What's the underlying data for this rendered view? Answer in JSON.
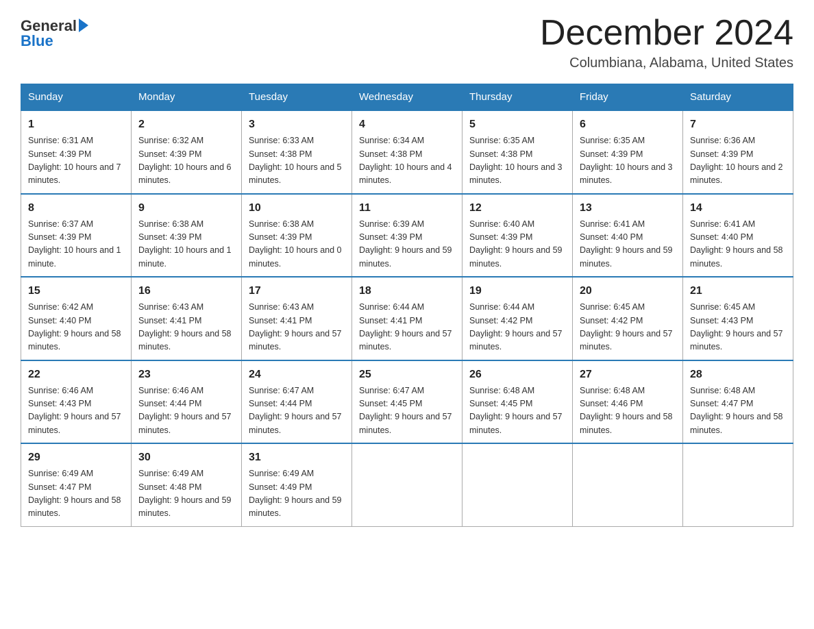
{
  "header": {
    "logo_text_general": "General",
    "logo_text_blue": "Blue",
    "month_title": "December 2024",
    "location": "Columbiana, Alabama, United States"
  },
  "days_of_week": [
    "Sunday",
    "Monday",
    "Tuesday",
    "Wednesday",
    "Thursday",
    "Friday",
    "Saturday"
  ],
  "weeks": [
    [
      {
        "day": "1",
        "sunrise": "Sunrise: 6:31 AM",
        "sunset": "Sunset: 4:39 PM",
        "daylight": "Daylight: 10 hours and 7 minutes."
      },
      {
        "day": "2",
        "sunrise": "Sunrise: 6:32 AM",
        "sunset": "Sunset: 4:39 PM",
        "daylight": "Daylight: 10 hours and 6 minutes."
      },
      {
        "day": "3",
        "sunrise": "Sunrise: 6:33 AM",
        "sunset": "Sunset: 4:38 PM",
        "daylight": "Daylight: 10 hours and 5 minutes."
      },
      {
        "day": "4",
        "sunrise": "Sunrise: 6:34 AM",
        "sunset": "Sunset: 4:38 PM",
        "daylight": "Daylight: 10 hours and 4 minutes."
      },
      {
        "day": "5",
        "sunrise": "Sunrise: 6:35 AM",
        "sunset": "Sunset: 4:38 PM",
        "daylight": "Daylight: 10 hours and 3 minutes."
      },
      {
        "day": "6",
        "sunrise": "Sunrise: 6:35 AM",
        "sunset": "Sunset: 4:39 PM",
        "daylight": "Daylight: 10 hours and 3 minutes."
      },
      {
        "day": "7",
        "sunrise": "Sunrise: 6:36 AM",
        "sunset": "Sunset: 4:39 PM",
        "daylight": "Daylight: 10 hours and 2 minutes."
      }
    ],
    [
      {
        "day": "8",
        "sunrise": "Sunrise: 6:37 AM",
        "sunset": "Sunset: 4:39 PM",
        "daylight": "Daylight: 10 hours and 1 minute."
      },
      {
        "day": "9",
        "sunrise": "Sunrise: 6:38 AM",
        "sunset": "Sunset: 4:39 PM",
        "daylight": "Daylight: 10 hours and 1 minute."
      },
      {
        "day": "10",
        "sunrise": "Sunrise: 6:38 AM",
        "sunset": "Sunset: 4:39 PM",
        "daylight": "Daylight: 10 hours and 0 minutes."
      },
      {
        "day": "11",
        "sunrise": "Sunrise: 6:39 AM",
        "sunset": "Sunset: 4:39 PM",
        "daylight": "Daylight: 9 hours and 59 minutes."
      },
      {
        "day": "12",
        "sunrise": "Sunrise: 6:40 AM",
        "sunset": "Sunset: 4:39 PM",
        "daylight": "Daylight: 9 hours and 59 minutes."
      },
      {
        "day": "13",
        "sunrise": "Sunrise: 6:41 AM",
        "sunset": "Sunset: 4:40 PM",
        "daylight": "Daylight: 9 hours and 59 minutes."
      },
      {
        "day": "14",
        "sunrise": "Sunrise: 6:41 AM",
        "sunset": "Sunset: 4:40 PM",
        "daylight": "Daylight: 9 hours and 58 minutes."
      }
    ],
    [
      {
        "day": "15",
        "sunrise": "Sunrise: 6:42 AM",
        "sunset": "Sunset: 4:40 PM",
        "daylight": "Daylight: 9 hours and 58 minutes."
      },
      {
        "day": "16",
        "sunrise": "Sunrise: 6:43 AM",
        "sunset": "Sunset: 4:41 PM",
        "daylight": "Daylight: 9 hours and 58 minutes."
      },
      {
        "day": "17",
        "sunrise": "Sunrise: 6:43 AM",
        "sunset": "Sunset: 4:41 PM",
        "daylight": "Daylight: 9 hours and 57 minutes."
      },
      {
        "day": "18",
        "sunrise": "Sunrise: 6:44 AM",
        "sunset": "Sunset: 4:41 PM",
        "daylight": "Daylight: 9 hours and 57 minutes."
      },
      {
        "day": "19",
        "sunrise": "Sunrise: 6:44 AM",
        "sunset": "Sunset: 4:42 PM",
        "daylight": "Daylight: 9 hours and 57 minutes."
      },
      {
        "day": "20",
        "sunrise": "Sunrise: 6:45 AM",
        "sunset": "Sunset: 4:42 PM",
        "daylight": "Daylight: 9 hours and 57 minutes."
      },
      {
        "day": "21",
        "sunrise": "Sunrise: 6:45 AM",
        "sunset": "Sunset: 4:43 PM",
        "daylight": "Daylight: 9 hours and 57 minutes."
      }
    ],
    [
      {
        "day": "22",
        "sunrise": "Sunrise: 6:46 AM",
        "sunset": "Sunset: 4:43 PM",
        "daylight": "Daylight: 9 hours and 57 minutes."
      },
      {
        "day": "23",
        "sunrise": "Sunrise: 6:46 AM",
        "sunset": "Sunset: 4:44 PM",
        "daylight": "Daylight: 9 hours and 57 minutes."
      },
      {
        "day": "24",
        "sunrise": "Sunrise: 6:47 AM",
        "sunset": "Sunset: 4:44 PM",
        "daylight": "Daylight: 9 hours and 57 minutes."
      },
      {
        "day": "25",
        "sunrise": "Sunrise: 6:47 AM",
        "sunset": "Sunset: 4:45 PM",
        "daylight": "Daylight: 9 hours and 57 minutes."
      },
      {
        "day": "26",
        "sunrise": "Sunrise: 6:48 AM",
        "sunset": "Sunset: 4:45 PM",
        "daylight": "Daylight: 9 hours and 57 minutes."
      },
      {
        "day": "27",
        "sunrise": "Sunrise: 6:48 AM",
        "sunset": "Sunset: 4:46 PM",
        "daylight": "Daylight: 9 hours and 58 minutes."
      },
      {
        "day": "28",
        "sunrise": "Sunrise: 6:48 AM",
        "sunset": "Sunset: 4:47 PM",
        "daylight": "Daylight: 9 hours and 58 minutes."
      }
    ],
    [
      {
        "day": "29",
        "sunrise": "Sunrise: 6:49 AM",
        "sunset": "Sunset: 4:47 PM",
        "daylight": "Daylight: 9 hours and 58 minutes."
      },
      {
        "day": "30",
        "sunrise": "Sunrise: 6:49 AM",
        "sunset": "Sunset: 4:48 PM",
        "daylight": "Daylight: 9 hours and 59 minutes."
      },
      {
        "day": "31",
        "sunrise": "Sunrise: 6:49 AM",
        "sunset": "Sunset: 4:49 PM",
        "daylight": "Daylight: 9 hours and 59 minutes."
      },
      null,
      null,
      null,
      null
    ]
  ]
}
